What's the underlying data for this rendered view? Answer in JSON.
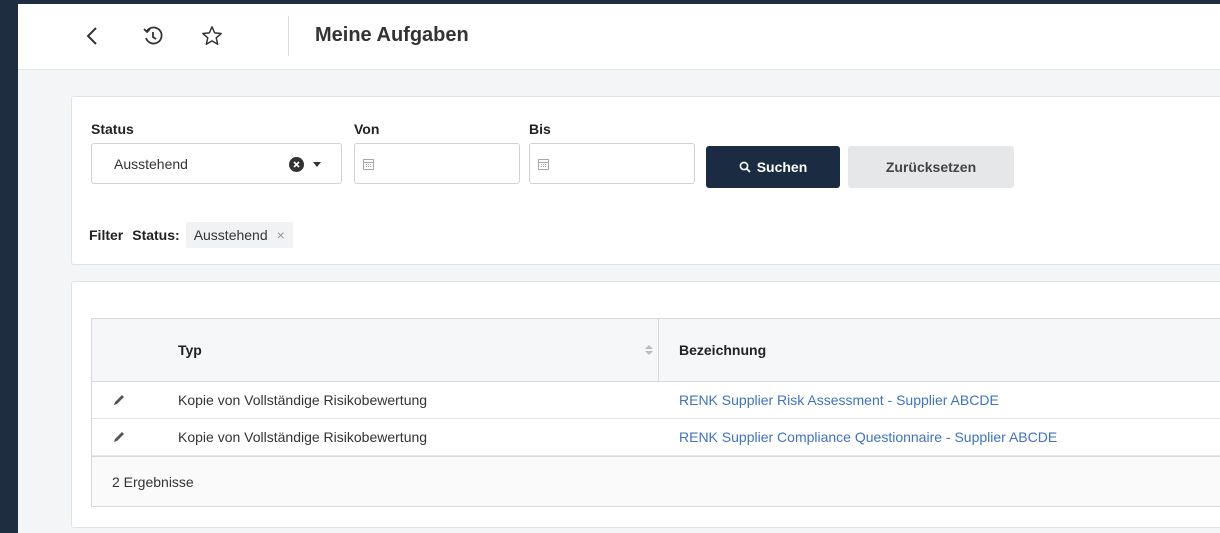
{
  "header": {
    "title": "Meine Aufgaben",
    "icons": [
      "back-icon",
      "history-icon",
      "star-icon"
    ]
  },
  "filters": {
    "status_label": "Status",
    "status_value": "Ausstehend",
    "von_label": "Von",
    "bis_label": "Bis",
    "search_label": "Suchen",
    "reset_label": "Zurücksetzen"
  },
  "active_filters": {
    "label": "Filter",
    "chip_key": "Status:",
    "chip_value": "Ausstehend",
    "chip_remove": "×"
  },
  "table": {
    "columns": {
      "typ": "Typ",
      "bezeichnung": "Bezeichnung"
    },
    "rows": [
      {
        "typ": "Kopie von Vollständige Risikobewertung",
        "bezeichnung": "RENK Supplier Risk Assessment - Supplier ABCDE"
      },
      {
        "typ": "Kopie von Vollständige Risikobewertung",
        "bezeichnung": "RENK Supplier Compliance Questionnaire - Supplier ABCDE"
      }
    ],
    "footer": "2 Ergebnisse"
  },
  "colors": {
    "primary_button": "#1b2c42",
    "link": "#3d72c8",
    "frame": "#1e2d40"
  }
}
